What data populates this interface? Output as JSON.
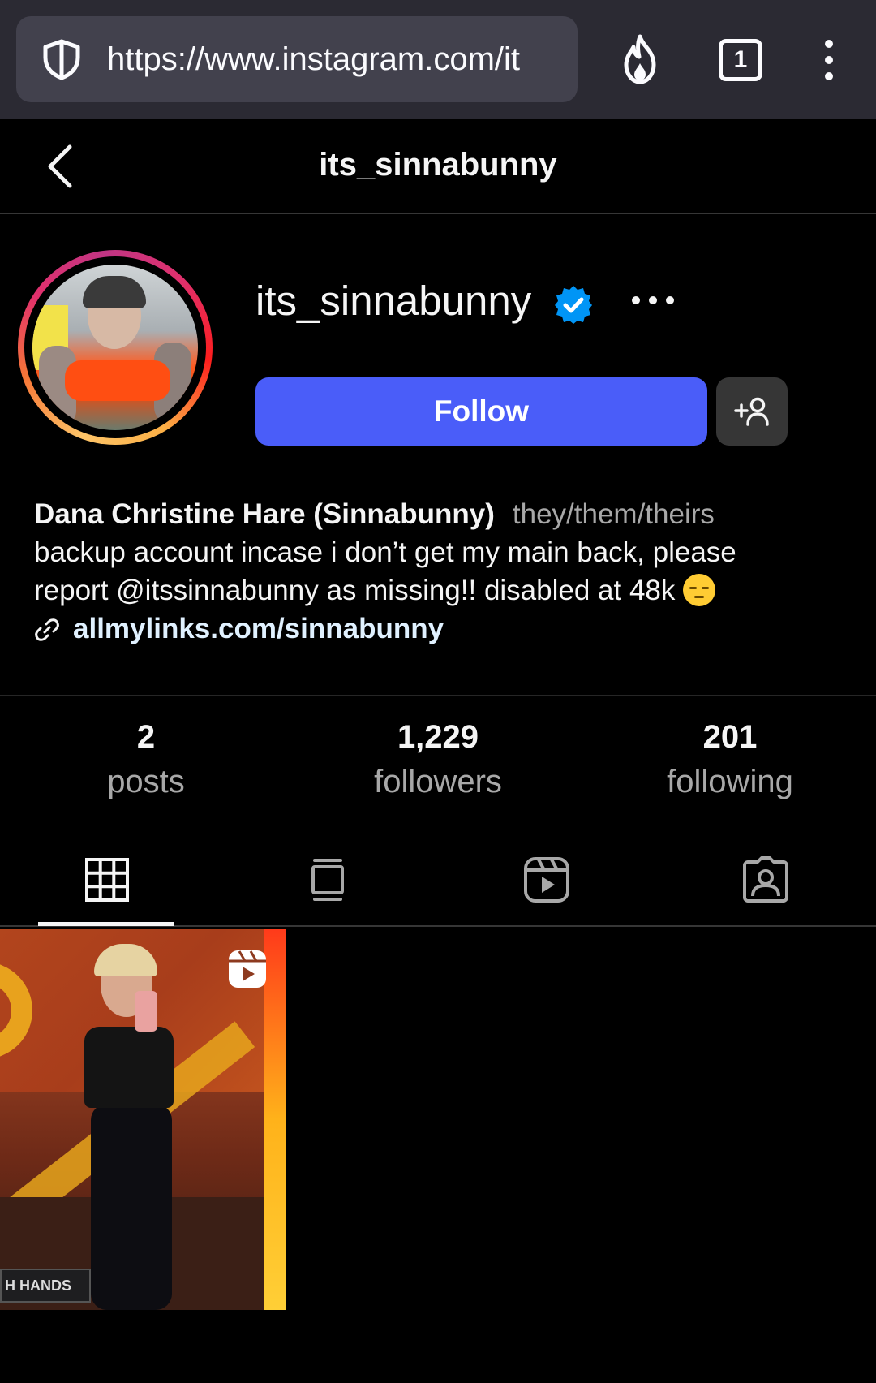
{
  "browser": {
    "url": "https://www.instagram.com/it",
    "tab_count": "1",
    "icons": [
      "shield-icon",
      "fire-icon",
      "tabs-counter",
      "kebab-menu-icon"
    ]
  },
  "header": {
    "title": "its_sinnabunny"
  },
  "profile": {
    "username": "its_sinnabunny",
    "verified": true,
    "follow_label": "Follow",
    "accent_color": "#4a5df9",
    "bio": {
      "name": "Dana Christine Hare (Sinnabunny)",
      "pronouns": "they/them/theirs",
      "line1": "backup account incase i don’t get my main back, please",
      "line2": "report @itssinnabunny as missing!! disabled at 48k",
      "link": "allmylinks.com/sinnabunny"
    }
  },
  "stats": [
    {
      "value": "2",
      "label": "posts"
    },
    {
      "value": "1,229",
      "label": "followers"
    },
    {
      "value": "201",
      "label": "following"
    }
  ],
  "tabs": [
    "grid-icon",
    "guides-icon",
    "reels-icon",
    "tagged-icon"
  ],
  "post": {
    "sign_text": "H HANDS",
    "type_icon": "reel-icon"
  }
}
